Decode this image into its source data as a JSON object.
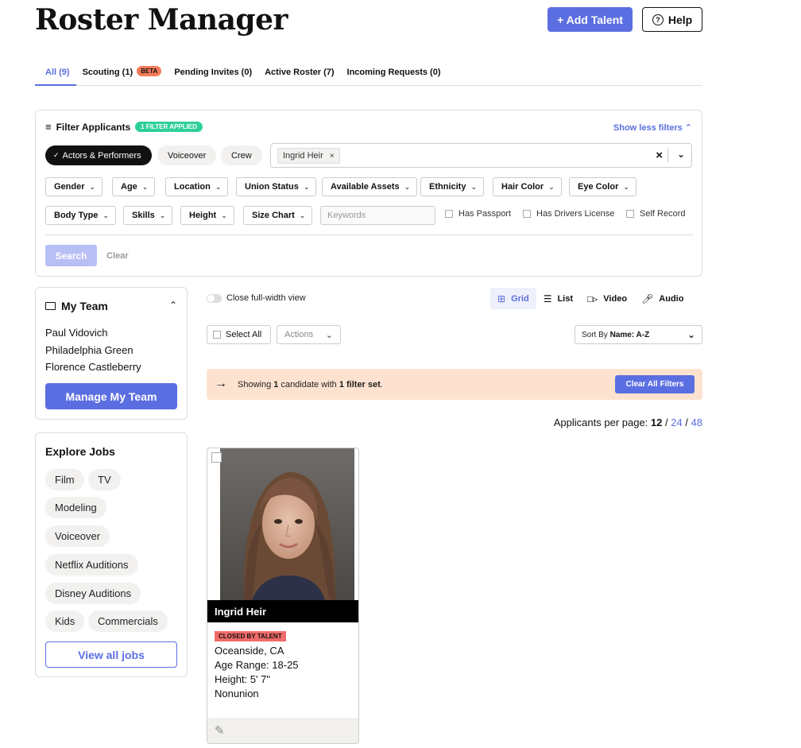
{
  "header": {
    "title": "Roster Manager",
    "add_talent": "+ Add Talent",
    "help": "Help"
  },
  "tabs": [
    {
      "label": "All (9)",
      "active": true
    },
    {
      "label": "Scouting (1)",
      "badge": "BETA"
    },
    {
      "label": "Pending Invites (0)"
    },
    {
      "label": "Active Roster (7)"
    },
    {
      "label": "Incoming Requests (0)"
    }
  ],
  "filters": {
    "title": "Filter Applicants",
    "badge": "1 FILTER APPLIED",
    "toggle_label": "Show less filters",
    "categories": [
      "Actors & Performers",
      "Voiceover",
      "Crew"
    ],
    "selected_token": "Ingrid Heir",
    "dropdowns": [
      "Gender",
      "Age",
      "Location",
      "Union Status",
      "Available Assets",
      "Ethnicity",
      "Hair Color",
      "Eye Color",
      "Body Type",
      "Skills",
      "Height",
      "Size Chart"
    ],
    "keywords_placeholder": "Keywords",
    "checkboxes": [
      "Has Passport",
      "Has Drivers License",
      "Self Record"
    ],
    "search": "Search",
    "clear": "Clear"
  },
  "team": {
    "title": "My Team",
    "members": [
      "Paul Vidovich",
      "Philadelphia Green",
      "Florence Castleberry"
    ],
    "manage": "Manage My Team"
  },
  "jobs": {
    "title": "Explore Jobs",
    "chips": [
      "Film",
      "TV",
      "Modeling",
      "Voiceover",
      "Netflix Auditions",
      "Disney Auditions",
      "Kids",
      "Commercials"
    ],
    "view_all": "View all jobs"
  },
  "toolbar": {
    "toggle_label": "Close full-width view",
    "views": [
      "Grid",
      "List",
      "Video",
      "Audio"
    ],
    "select_all": "Select All",
    "actions": "Actions",
    "sort_prefix": "Sort By",
    "sort_value": "Name: A-Z"
  },
  "banner": {
    "text_pre": "Showing ",
    "count": "1",
    "text_mid": " candidate with ",
    "filters": "1 filter set",
    "text_post": ".",
    "clear_all": "Clear All Filters"
  },
  "per_page": {
    "label": "Applicants per page: ",
    "current": "12",
    "opt1": "24",
    "opt2": "48",
    "sep": " / "
  },
  "talent": {
    "name": "Ingrid Heir",
    "status": "CLOSED BY TALENT",
    "location": "Oceanside, CA",
    "age_range": "Age Range: 18-25",
    "height": "Height: 5' 7\"",
    "union": "Nonunion"
  },
  "colors": {
    "accent": "#5b6ee1",
    "badge_green": "#2fcf9a",
    "banner_bg": "#fde3cf",
    "closed_red": "#f26b6b"
  }
}
